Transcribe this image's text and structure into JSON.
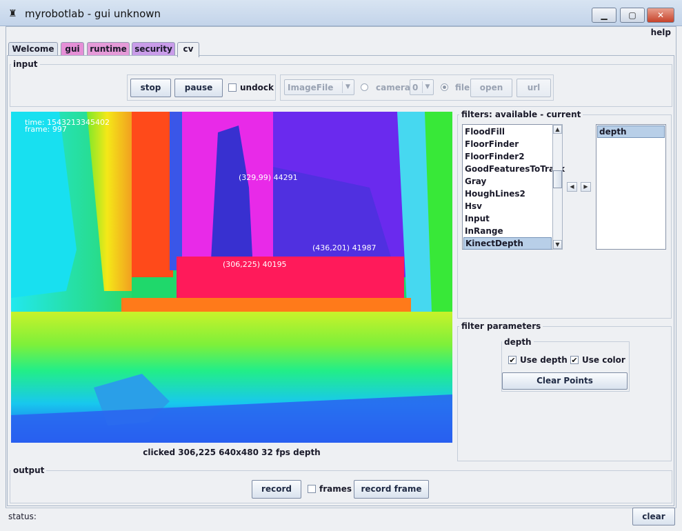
{
  "window": {
    "title": "myrobotlab - gui unknown",
    "app_icon": "robot-icon",
    "minimize_glyph": "▁",
    "maximize_glyph": "▢",
    "close_glyph": "✕"
  },
  "menu": {
    "help_label": "help"
  },
  "tabs": [
    {
      "label": "Welcome",
      "color": "#dfe5ee"
    },
    {
      "label": "gui",
      "color": "#e58fd6"
    },
    {
      "label": "runtime",
      "color": "#e59ad8"
    },
    {
      "label": "security",
      "color": "#c99ce9"
    },
    {
      "label": "cv",
      "color": "#eef0f3"
    }
  ],
  "input": {
    "group_title": "input",
    "stop_label": "stop",
    "pause_label": "pause",
    "undock_label": "undock",
    "grabber_select_value": "ImageFile",
    "camera_label": "camera",
    "camera_select_value": "0",
    "file_label": "file",
    "open_label": "open",
    "url_label": "url"
  },
  "video": {
    "time_text": "time: 1543213345402",
    "frame_text": "frame: 997",
    "points": [
      {
        "label": "(329,99) 44291"
      },
      {
        "label": "(436,201) 41987"
      },
      {
        "label": "(306,225) 40195"
      }
    ],
    "status_line": "clicked 306,225  640x480  32 fps  depth"
  },
  "filters": {
    "group_title": "filters: available - current",
    "available": [
      "FloodFill",
      "FloorFinder",
      "FloorFinder2",
      "GoodFeaturesToTrack",
      "Gray",
      "HoughLines2",
      "Hsv",
      "Input",
      "InRange",
      "KinectDepth"
    ],
    "selected_available": "KinectDepth",
    "current": [
      "depth"
    ],
    "arrow_left": "◀",
    "arrow_right": "▶",
    "scroll_up": "▲",
    "scroll_down": "▼"
  },
  "filter_params": {
    "group_title": "filter parameters",
    "subgroup_title": "depth",
    "use_depth_label": "Use depth",
    "use_color_label": "Use color",
    "check_glyph": "✔",
    "clear_points_label": "Clear Points"
  },
  "output": {
    "group_title": "output",
    "record_label": "record",
    "frames_label": "frames",
    "record_frame_label": "record frame"
  },
  "status": {
    "label": "status:",
    "clear_label": "clear"
  }
}
